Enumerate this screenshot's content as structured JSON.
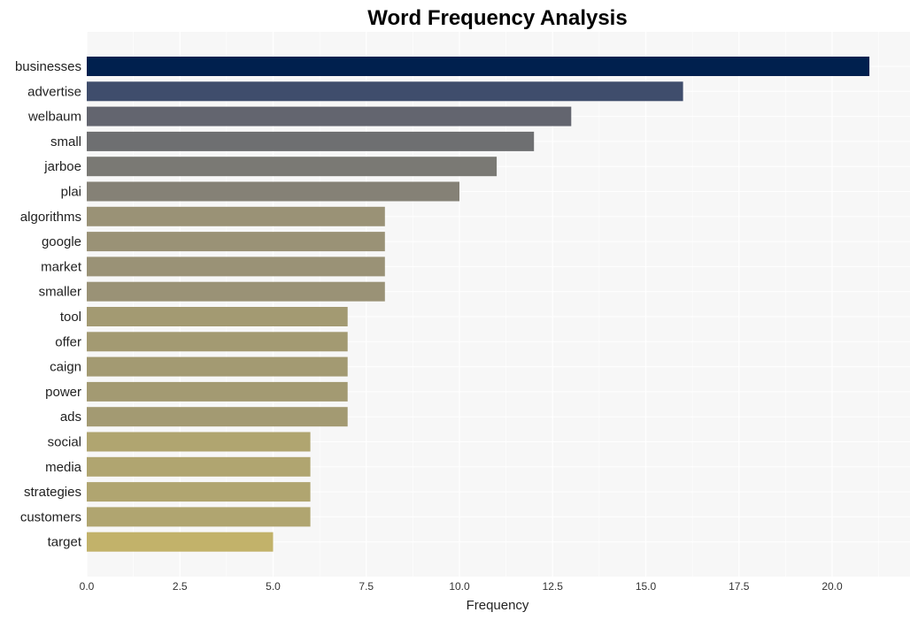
{
  "chart_data": {
    "type": "bar",
    "orientation": "horizontal",
    "title": "Word Frequency Analysis",
    "xlabel": "Frequency",
    "ylabel": "",
    "xlim": [
      0,
      22
    ],
    "xticks": [
      "0.0",
      "2.5",
      "5.0",
      "7.5",
      "10.0",
      "12.5",
      "15.0",
      "17.5",
      "20.0"
    ],
    "xtick_values": [
      0,
      2.5,
      5,
      7.5,
      10,
      12.5,
      15,
      17.5,
      20
    ],
    "grid": true,
    "categories": [
      "businesses",
      "advertise",
      "welbaum",
      "small",
      "jarboe",
      "plai",
      "algorithms",
      "google",
      "market",
      "smaller",
      "tool",
      "offer",
      "caign",
      "power",
      "ads",
      "social",
      "media",
      "strategies",
      "customers",
      "target"
    ],
    "values": [
      21,
      16,
      13,
      12,
      11,
      10,
      8,
      8,
      8,
      8,
      7,
      7,
      7,
      7,
      7,
      6,
      6,
      6,
      6,
      5
    ],
    "colors": [
      "#00204e",
      "#3f4d6c",
      "#63656f",
      "#6e6f71",
      "#7a7974",
      "#858176",
      "#9a9276",
      "#9a9276",
      "#9a9276",
      "#9a9276",
      "#a39a72",
      "#a39a72",
      "#a39a72",
      "#a39a72",
      "#a39a72",
      "#b0a570",
      "#b0a570",
      "#b0a570",
      "#b0a570",
      "#c2b26a"
    ]
  }
}
